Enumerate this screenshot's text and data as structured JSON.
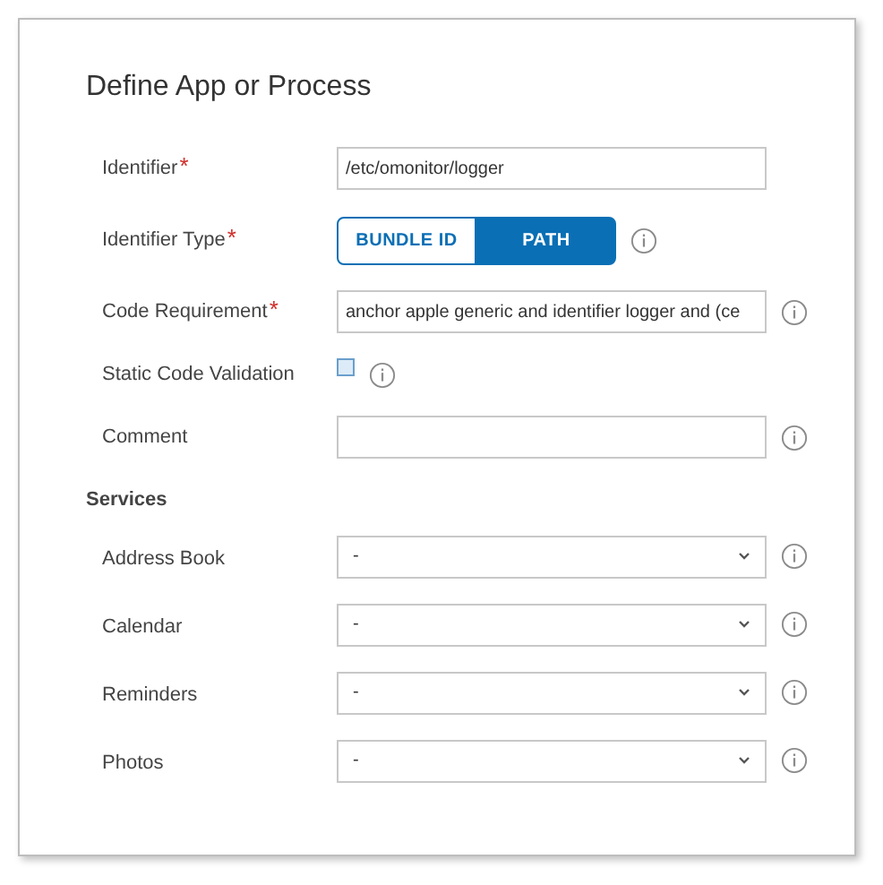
{
  "title": "Define App or Process",
  "fields": [
    {
      "kind": "text",
      "label": "Identifier",
      "required_mark": "*",
      "value": "/etc/omonitor/logger",
      "info": false
    },
    {
      "kind": "segmented",
      "label": "Identifier Type",
      "required_mark": "*",
      "options": [
        {
          "label": "BUNDLE ID",
          "selected": false
        },
        {
          "label": "PATH",
          "selected": true
        }
      ],
      "info": true
    },
    {
      "kind": "text",
      "label": "Code Requirement",
      "required_mark": "*",
      "value": "anchor apple generic and identifier logger and (ce",
      "info": true
    },
    {
      "kind": "checkbox",
      "label": "Static Code Validation",
      "checked": false,
      "info": true
    },
    {
      "kind": "text",
      "label": "Comment",
      "info": true
    }
  ],
  "services_heading": "Services",
  "services": [
    {
      "label": "Address Book",
      "value": "-"
    },
    {
      "label": "Calendar",
      "value": "-"
    },
    {
      "label": "Reminders",
      "value": "-"
    },
    {
      "label": "Photos",
      "value": "-"
    }
  ]
}
